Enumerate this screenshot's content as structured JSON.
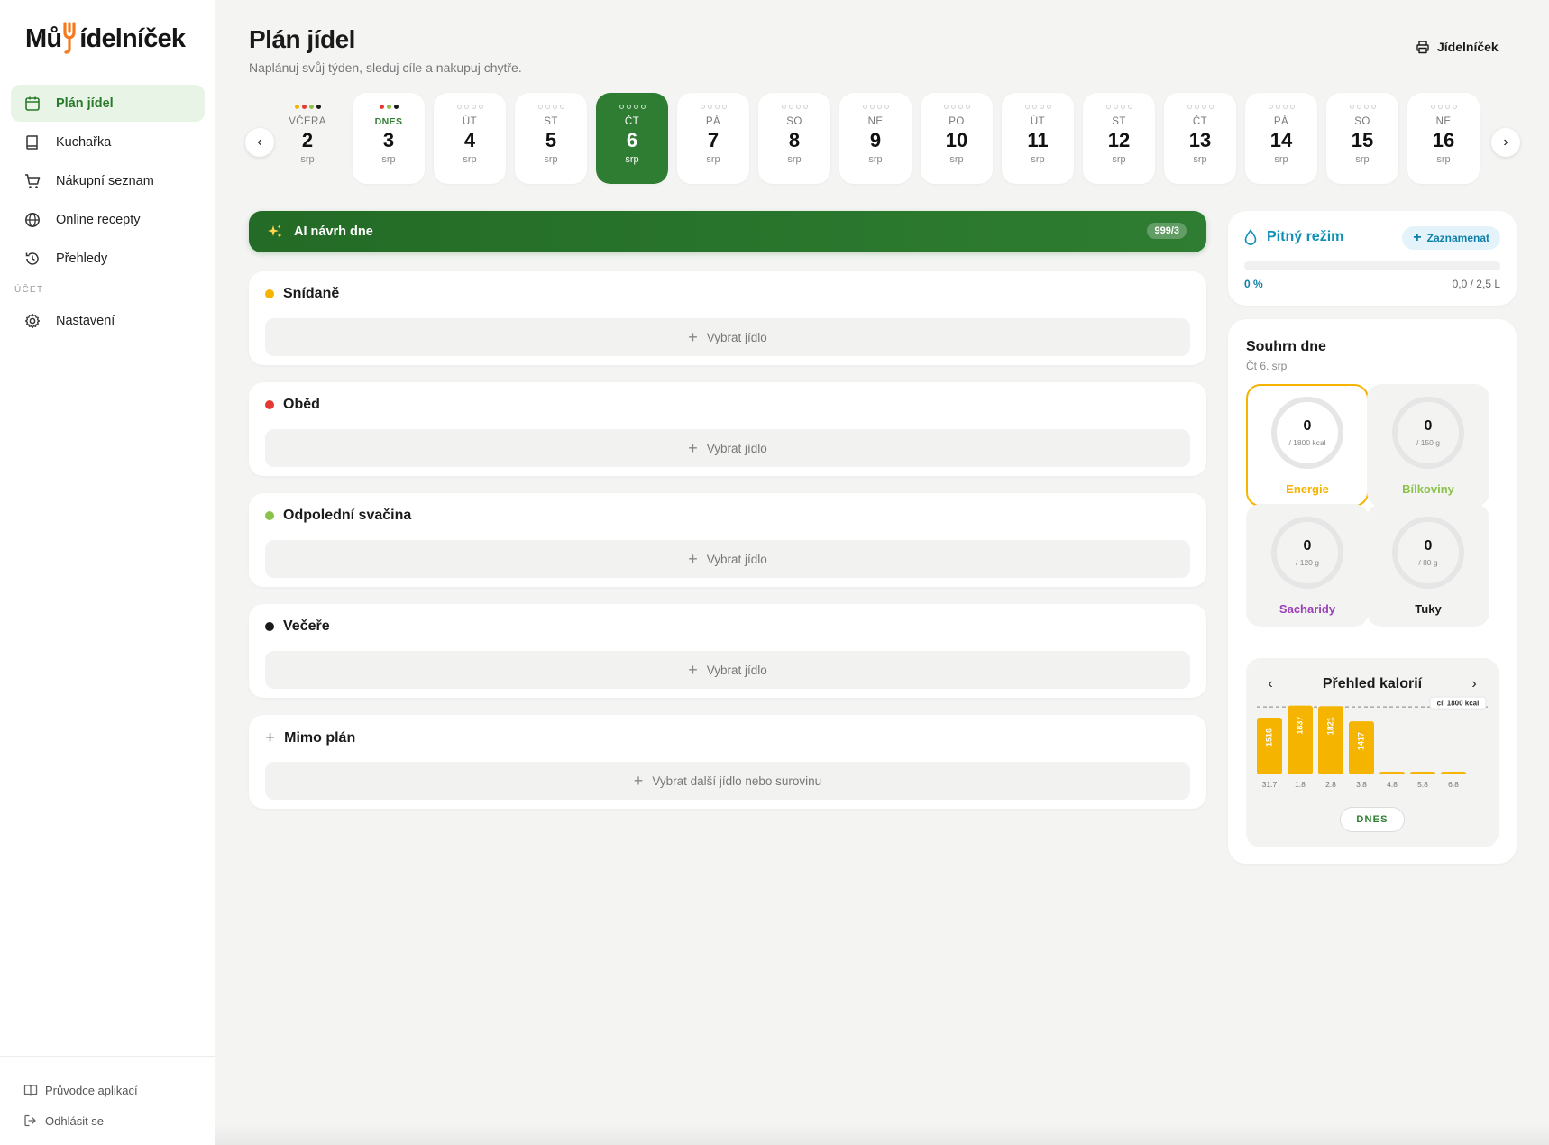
{
  "app": {
    "logo_text_before": "Mů",
    "logo_text_after": "ídelníček"
  },
  "sidebar": {
    "items": [
      {
        "label": "Plán jídel",
        "icon": "calendar-icon",
        "active": true
      },
      {
        "label": "Kuchařka",
        "icon": "book-icon",
        "active": false
      },
      {
        "label": "Nákupní seznam",
        "icon": "cart-icon",
        "active": false
      },
      {
        "label": "Online recepty",
        "icon": "globe-icon",
        "active": false
      },
      {
        "label": "Přehledy",
        "icon": "history-icon",
        "active": false
      }
    ],
    "section_label": "ÚČET",
    "settings_label": "Nastavení",
    "bottom": {
      "guide_label": "Průvodce aplikací",
      "logout_label": "Odhlásit se"
    }
  },
  "header": {
    "title": "Plán jídel",
    "subtitle": "Naplánuj svůj týden, sleduj cíle a nakupuj chytře.",
    "print_label": "Jídelníček"
  },
  "days": [
    {
      "label": "VČERA",
      "num": "2",
      "month": "srp",
      "dots": [
        "#f5b400",
        "#e53935",
        "#8bc34a",
        "#1a1a1a"
      ],
      "style": "plain"
    },
    {
      "label": "DNES",
      "num": "3",
      "month": "srp",
      "dots": [
        "#e53935",
        "#8bc34a",
        "#1a1a1a"
      ],
      "style": "today"
    },
    {
      "label": "ÚT",
      "num": "4",
      "month": "srp",
      "dots": [],
      "style": "card"
    },
    {
      "label": "ST",
      "num": "5",
      "month": "srp",
      "dots": [],
      "style": "card"
    },
    {
      "label": "ČT",
      "num": "6",
      "month": "srp",
      "dots": [],
      "style": "selected"
    },
    {
      "label": "PÁ",
      "num": "7",
      "month": "srp",
      "dots": [],
      "style": "card"
    },
    {
      "label": "SO",
      "num": "8",
      "month": "srp",
      "dots": [],
      "style": "card"
    },
    {
      "label": "NE",
      "num": "9",
      "month": "srp",
      "dots": [],
      "style": "card"
    },
    {
      "label": "PO",
      "num": "10",
      "month": "srp",
      "dots": [],
      "style": "card"
    },
    {
      "label": "ÚT",
      "num": "11",
      "month": "srp",
      "dots": [],
      "style": "card"
    },
    {
      "label": "ST",
      "num": "12",
      "month": "srp",
      "dots": [],
      "style": "card"
    },
    {
      "label": "ČT",
      "num": "13",
      "month": "srp",
      "dots": [],
      "style": "card"
    },
    {
      "label": "PÁ",
      "num": "14",
      "month": "srp",
      "dots": [],
      "style": "card"
    },
    {
      "label": "SO",
      "num": "15",
      "month": "srp",
      "dots": [],
      "style": "card"
    },
    {
      "label": "NE",
      "num": "16",
      "month": "srp",
      "dots": [],
      "style": "card"
    }
  ],
  "ai": {
    "title": "AI návrh dne",
    "badge": "999/3"
  },
  "meals": [
    {
      "name": "Snídaně",
      "color": "#f5b400",
      "add_label": "Vybrat jídlo",
      "marker": "dot"
    },
    {
      "name": "Oběd",
      "color": "#e53935",
      "add_label": "Vybrat jídlo",
      "marker": "dot"
    },
    {
      "name": "Odpolední svačina",
      "color": "#8bc34a",
      "add_label": "Vybrat jídlo",
      "marker": "dot"
    },
    {
      "name": "Večeře",
      "color": "#1a1a1a",
      "add_label": "Vybrat jídlo",
      "marker": "dot"
    },
    {
      "name": "Mimo plán",
      "color": "#555555",
      "add_label": "Vybrat další jídlo nebo surovinu",
      "marker": "plus"
    }
  ],
  "water": {
    "title": "Pitný režim",
    "record_label": "Zaznamenat",
    "percent": "0 %",
    "fill_fraction": 0,
    "amount": "0,0 / 2,5 L"
  },
  "summary": {
    "title": "Souhrn dne",
    "date": "Čt 6. srp",
    "macros": [
      {
        "name": "Energie",
        "value": "0",
        "target": "/ 1800 kcal",
        "color": "#f5b400",
        "active": true
      },
      {
        "name": "Bílkoviny",
        "value": "0",
        "target": "/ 150 g",
        "color": "#8bc34a",
        "active": false
      },
      {
        "name": "Sacharidy",
        "value": "0",
        "target": "/ 120 g",
        "color": "#9c3fb8",
        "active": false
      },
      {
        "name": "Tuky",
        "value": "0",
        "target": "/ 80 g",
        "color": "#1a1a1a",
        "active": false
      }
    ]
  },
  "kcal": {
    "title": "Přehled kalorií",
    "today_label": "DNES"
  },
  "chart_data": {
    "type": "bar",
    "title": "Přehled kalorií",
    "categories": [
      "31.7",
      "1.8",
      "2.8",
      "3.8",
      "4.8",
      "5.8",
      "6.8"
    ],
    "values": [
      1516,
      1837,
      1821,
      1417,
      0,
      0,
      0
    ],
    "value_labels": [
      "1516",
      "1837",
      "1821",
      "1417",
      "",
      "",
      ""
    ],
    "target_value": 1800,
    "target_label": "cíl 1800 kcal",
    "ylim": [
      0,
      1900
    ],
    "bar_color": "#f5b400"
  }
}
